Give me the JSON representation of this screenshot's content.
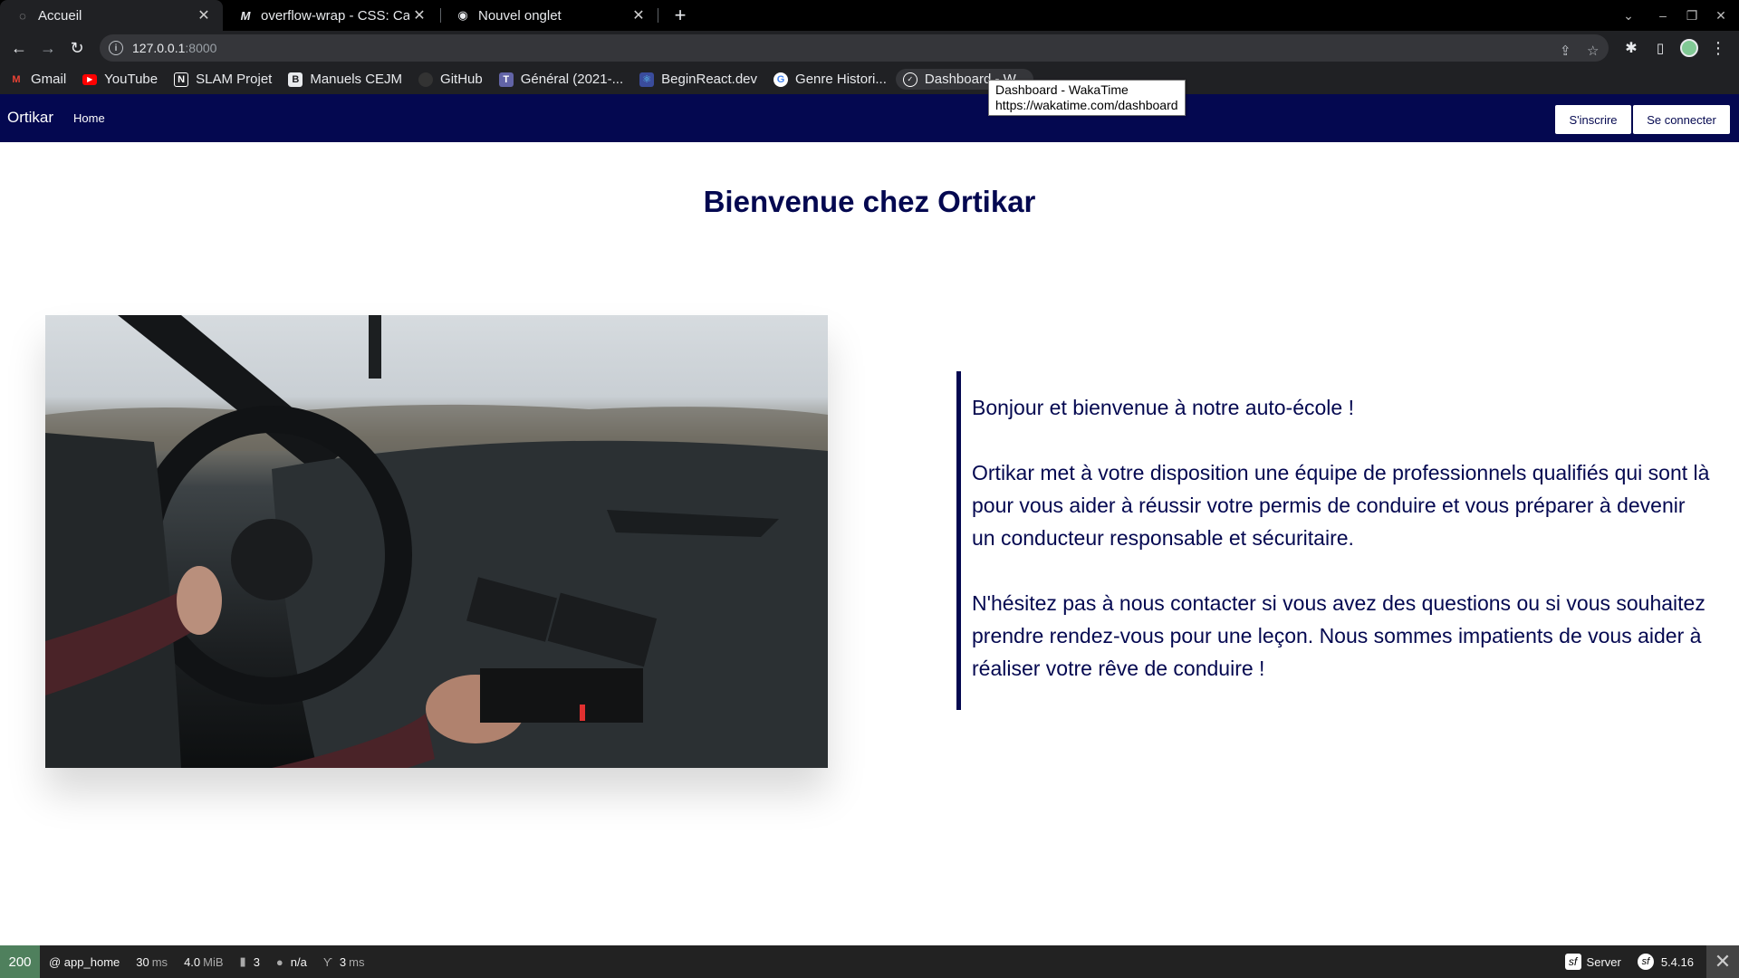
{
  "browser": {
    "tabs": [
      {
        "title": "Accueil",
        "icon": "globe-icon",
        "active": true
      },
      {
        "title": "overflow-wrap - CSS: Casc",
        "icon": "mdn-icon",
        "active": false
      },
      {
        "title": "Nouvel onglet",
        "icon": "chrome-icon",
        "active": false
      }
    ],
    "url_host": "127.0.0.1",
    "url_port": ":8000",
    "bookmarks": [
      {
        "label": "Gmail",
        "icon": "gmail-icon",
        "color": "#ea4335",
        "glyph": "M"
      },
      {
        "label": "YouTube",
        "icon": "youtube-icon",
        "color": "#ff0000",
        "glyph": "▶"
      },
      {
        "label": "SLAM Projet",
        "icon": "notion-icon",
        "color": "#ffffff",
        "glyph": "N"
      },
      {
        "label": "Manuels CEJM",
        "icon": "book-icon",
        "color": "#e8eaed",
        "glyph": "B"
      },
      {
        "label": "GitHub",
        "icon": "github-icon",
        "color": "#444444",
        "glyph": "●"
      },
      {
        "label": "Général (2021-...",
        "icon": "teams-icon",
        "color": "#6264a7",
        "glyph": "T"
      },
      {
        "label": "BeginReact.dev",
        "icon": "react-icon",
        "color": "#3a4c9c",
        "glyph": "⚛"
      },
      {
        "label": "Genre Histori...",
        "icon": "google-icon",
        "color": "#ffffff",
        "glyph": "G"
      },
      {
        "label": "Dashboard - W...",
        "icon": "wakatime-icon",
        "color": "#ffffff",
        "glyph": "◎"
      }
    ],
    "tooltip": {
      "title": "Dashboard - WakaTime",
      "url": "https://wakatime.com/dashboard"
    }
  },
  "site": {
    "brand": "Ortikar",
    "nav_home": "Home",
    "signup": "S'inscrire",
    "login": "Se connecter",
    "title": "Bienvenue chez Ortikar",
    "paragraphs": [
      "Bonjour et bienvenue à notre auto-école !",
      "Ortikar met à votre disposition une équipe de professionnels qualifiés qui sont là pour vous aider à réussir votre permis de conduire et vous préparer à devenir un conducteur responsable et sécuritaire.",
      "N'hésitez pas à nous contacter si vous avez des questions ou si vous souhaitez prendre rendez-vous pour une leçon. Nous sommes impatients de vous aider à réaliser votre rêve de conduire !"
    ],
    "accent_color": "#040850"
  },
  "debug_toolbar": {
    "status": "200",
    "route": "@ app_home",
    "time": "30",
    "time_unit": "ms",
    "memory": "4.0",
    "memory_unit": "MiB",
    "db_queries": "3",
    "user": "n/a",
    "twig_time": "3",
    "twig_unit": "ms",
    "server_label": "Server",
    "version": "5.4.16"
  }
}
